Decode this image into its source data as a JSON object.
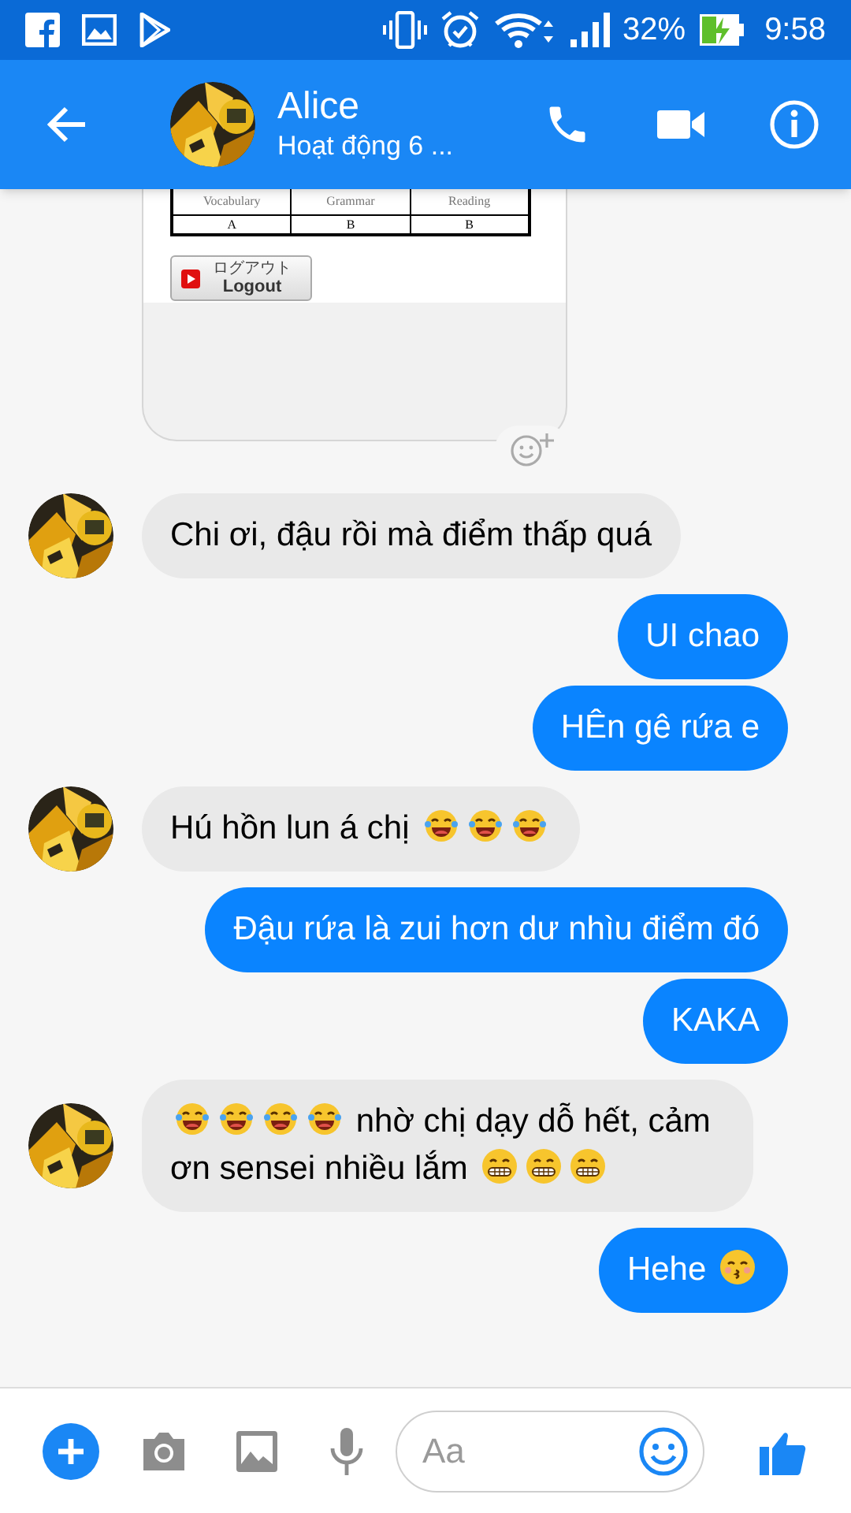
{
  "status_bar": {
    "battery": "32%",
    "time": "9:58"
  },
  "header": {
    "name": "Alice",
    "status": "Hoạt động 6 ..."
  },
  "attachment": {
    "table": {
      "columns": [
        "Vocabulary",
        "Grammar",
        "Reading"
      ],
      "rows": [
        [
          "A",
          "B",
          "B"
        ]
      ]
    },
    "logout_button": {
      "label_ja": "ログアウト",
      "label": "Logout"
    }
  },
  "messages": [
    {
      "outgoing": false,
      "segments": [
        {
          "kind": "text",
          "text": "Chi ơi, đậu rồi mà điểm thấp quá"
        }
      ]
    },
    {
      "outgoing": true,
      "segments": [
        {
          "kind": "text",
          "text": "UI chao"
        }
      ]
    },
    {
      "outgoing": true,
      "segments": [
        {
          "kind": "text",
          "text": "HÊn gê rứa e"
        }
      ]
    },
    {
      "outgoing": false,
      "segments": [
        {
          "kind": "text",
          "text": "Hú hồn lun á chị"
        },
        {
          "kind": "laugh"
        },
        {
          "kind": "laugh"
        },
        {
          "kind": "laugh"
        }
      ]
    },
    {
      "outgoing": true,
      "segments": [
        {
          "kind": "text",
          "text": "Đậu rứa là zui hơn dư nhìu điểm đó"
        }
      ]
    },
    {
      "outgoing": true,
      "segments": [
        {
          "kind": "text",
          "text": "KAKA"
        }
      ]
    },
    {
      "outgoing": false,
      "segments": [
        {
          "kind": "laugh"
        },
        {
          "kind": "laugh"
        },
        {
          "kind": "laugh"
        },
        {
          "kind": "laugh"
        },
        {
          "kind": "text",
          "text": "nhờ chị dạy dỗ hết, cảm ơn sensei nhiều lắm"
        },
        {
          "kind": "grin"
        },
        {
          "kind": "grin"
        },
        {
          "kind": "grin"
        }
      ]
    },
    {
      "outgoing": true,
      "segments": [
        {
          "kind": "text",
          "text": "Hehe"
        },
        {
          "kind": "kiss"
        }
      ]
    }
  ],
  "composer": {
    "placeholder": "Aa"
  }
}
